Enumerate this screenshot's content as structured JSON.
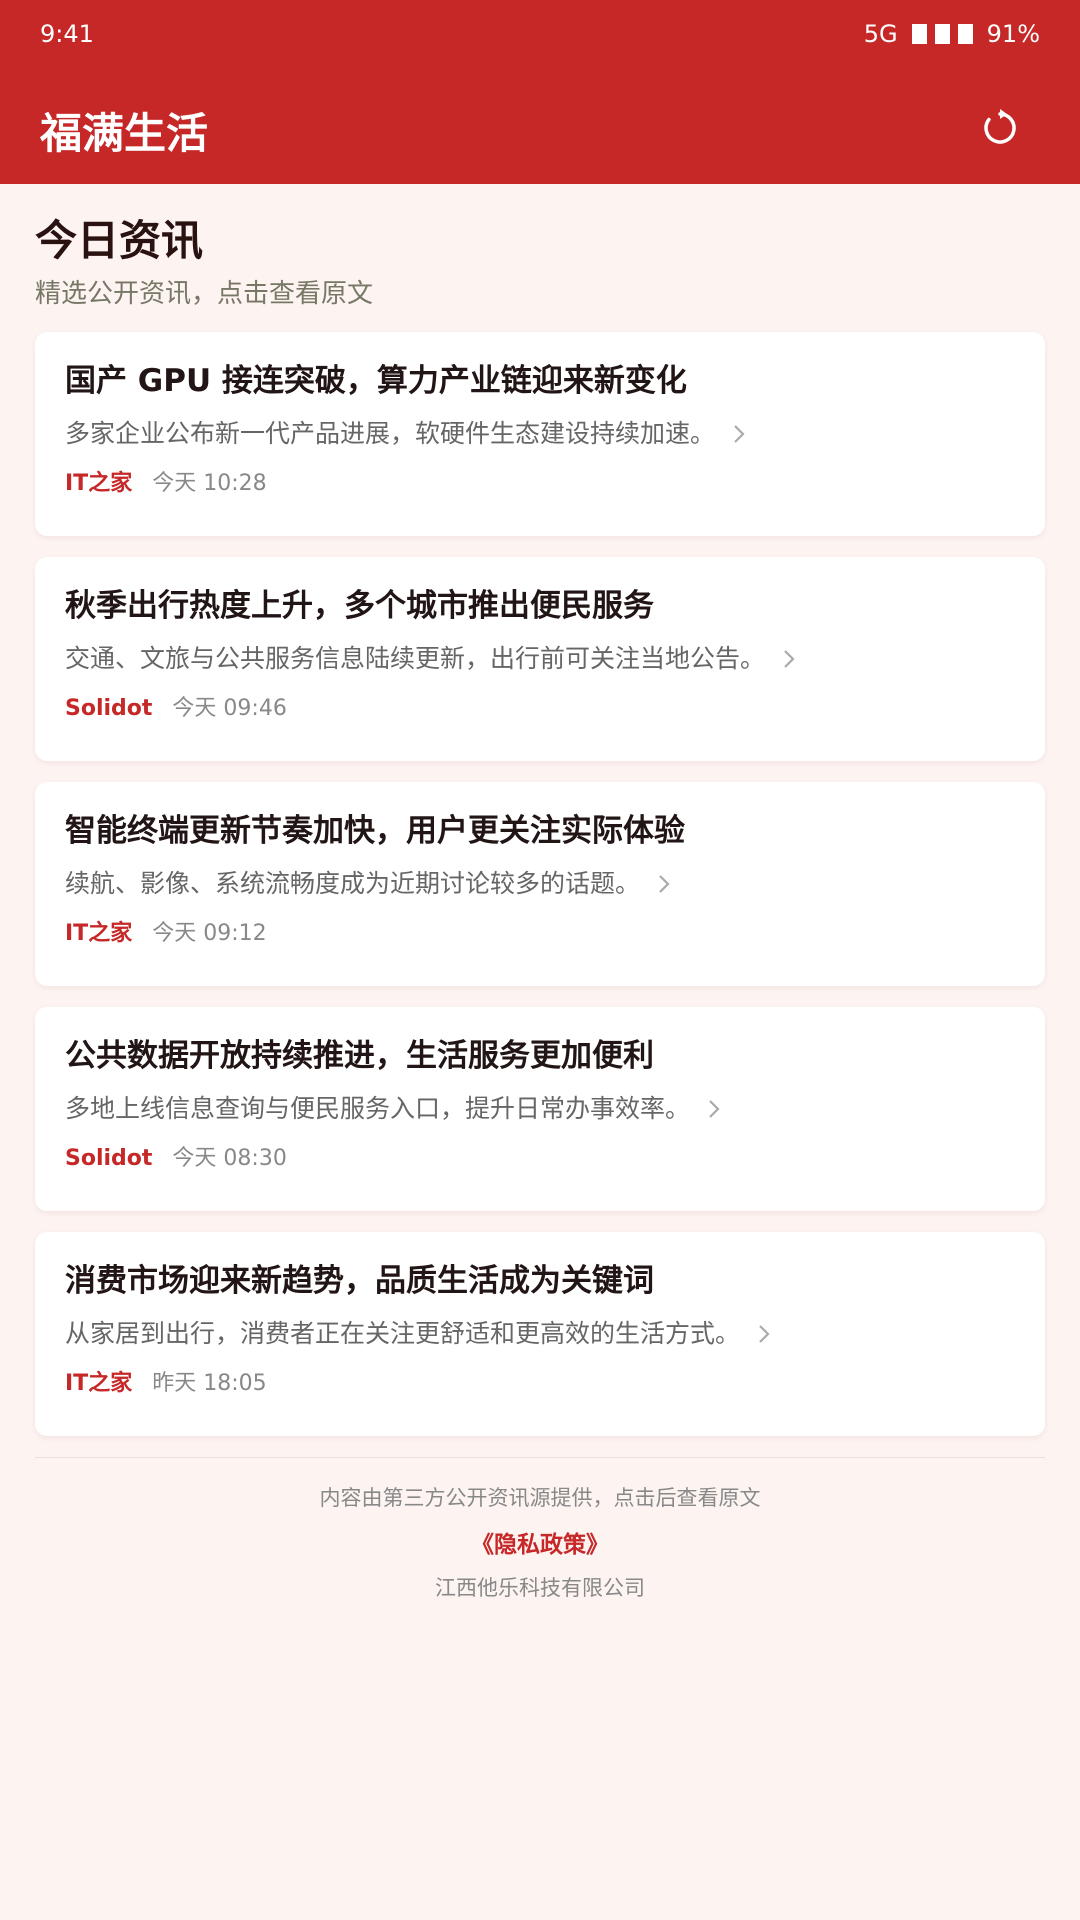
{
  "status_bar": {
    "time": "9:41",
    "network": "5G",
    "battery": "91%"
  },
  "header": {
    "title": "福满生活",
    "refresh_icon": "refresh-icon"
  },
  "main": {
    "title": "今日资讯",
    "subtitle": "精选公开资讯，点击查看原文",
    "news": [
      {
        "title": "国产 GPU 接连突破，算力产业链迎来新变化",
        "summary": "多家企业公布新一代产品进展，软硬件生态建设持续加速。",
        "source": "IT之家",
        "time": "今天 10:28"
      },
      {
        "title": "秋季出行热度上升，多个城市推出便民服务",
        "summary": "交通、文旅与公共服务信息陆续更新，出行前可关注当地公告。",
        "source": "Solidot",
        "time": "今天 09:46"
      },
      {
        "title": "智能终端更新节奏加快，用户更关注实际体验",
        "summary": "续航、影像、系统流畅度成为近期讨论较多的话题。",
        "source": "IT之家",
        "time": "今天 09:12"
      },
      {
        "title": "公共数据开放持续推进，生活服务更加便利",
        "summary": "多地上线信息查询与便民服务入口，提升日常办事效率。",
        "source": "Solidot",
        "time": "今天 08:30"
      },
      {
        "title": "消费市场迎来新趋势，品质生活成为关键词",
        "summary": "从家居到出行，消费者正在关注更舒适和更高效的生活方式。",
        "source": "IT之家",
        "time": "昨天 18:05"
      }
    ]
  },
  "footer": {
    "note": "内容由第三方公开资讯源提供，点击后查看原文",
    "privacy_link": "《隐私政策》",
    "company": "江西他乐科技有限公司"
  },
  "colors": {
    "brand": "#c62828",
    "background": "#fdf4f2"
  }
}
